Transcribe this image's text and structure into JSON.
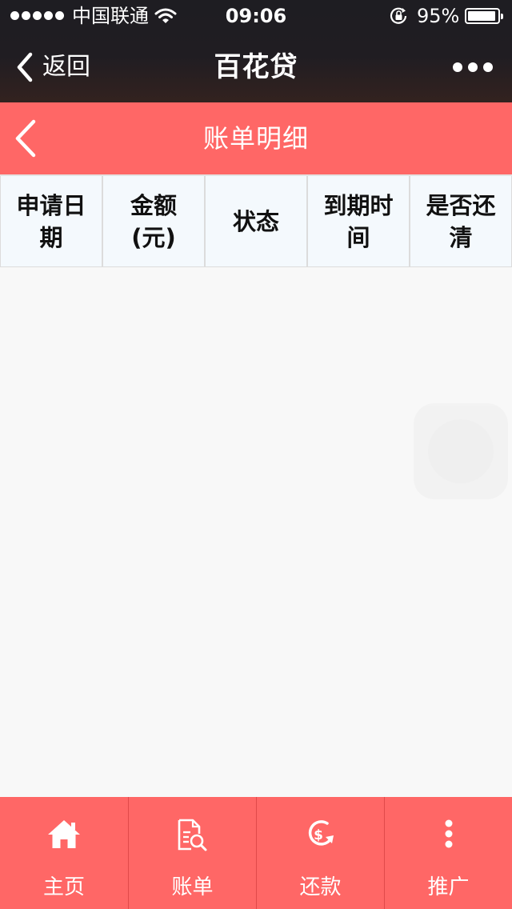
{
  "status_bar": {
    "carrier": "中国联通",
    "time": "09:06",
    "battery_percent": "95%",
    "battery_level": 0.95
  },
  "wechat_nav": {
    "back_label": "返回",
    "title": "百花贷",
    "more_icon": "more-dots-icon"
  },
  "page_header": {
    "title": "账单明细",
    "back_icon": "chevron-left-icon"
  },
  "table": {
    "columns": [
      {
        "label": "申请日期"
      },
      {
        "label": "金额(元)"
      },
      {
        "label": "状态"
      },
      {
        "label": "到期时间"
      },
      {
        "label": "是否还清"
      }
    ],
    "rows": []
  },
  "tab_bar": {
    "items": [
      {
        "label": "主页",
        "icon": "home-icon"
      },
      {
        "label": "账单",
        "icon": "bill-search-icon"
      },
      {
        "label": "还款",
        "icon": "repay-dollar-icon"
      },
      {
        "label": "推广",
        "icon": "vertical-dots-icon"
      }
    ]
  },
  "colors": {
    "accent": "#ff6766",
    "nav_dark": "#1e1d22",
    "table_header_bg": "#f4f9fd",
    "page_bg": "#f8f8f8"
  }
}
